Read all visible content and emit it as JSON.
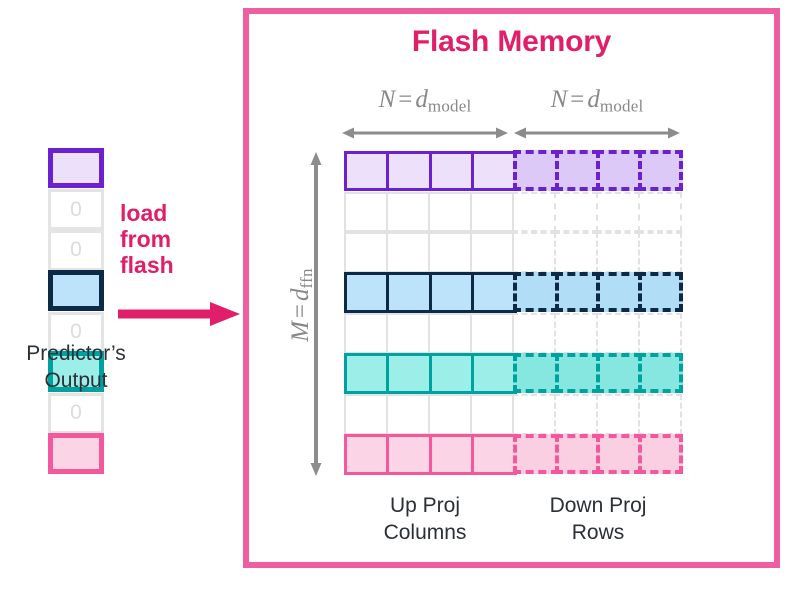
{
  "frame": {
    "title": "Flash Memory",
    "border_color": "#ef5e9e",
    "title_color": "#e01e6a"
  },
  "dimension_labels": {
    "n_var": "N",
    "n_eq": "=",
    "n_d": "d",
    "n_sub": "model",
    "m_var": "M",
    "m_eq": "=",
    "m_d": "d",
    "m_sub": "ffn",
    "arrow_color": "#8c8c8c"
  },
  "captions": {
    "up_proj": "Up Proj\nColumns",
    "up_proj_line1": "Up Proj",
    "up_proj_line2": "Columns",
    "down_proj_line1": "Down Proj",
    "down_proj_line2": "Rows",
    "predictor_line1": "Predictor’s",
    "predictor_line2": "Output",
    "text_color": "#2b3036"
  },
  "transfer": {
    "line1": "load",
    "line2": "from",
    "line3": "flash",
    "color": "#e01e6a"
  },
  "predictor_output": {
    "zero_label": "0",
    "cells": [
      {
        "state": "active",
        "color_key": "purple"
      },
      {
        "state": "zero",
        "color_key": "gray"
      },
      {
        "state": "zero",
        "color_key": "gray"
      },
      {
        "state": "active",
        "color_key": "navy"
      },
      {
        "state": "zero",
        "color_key": "gray"
      },
      {
        "state": "active",
        "color_key": "teal"
      },
      {
        "state": "zero",
        "color_key": "gray"
      },
      {
        "state": "active",
        "color_key": "pink"
      }
    ]
  },
  "matrix": {
    "rows": 8,
    "left_columns": 4,
    "right_columns": 4,
    "active_rows": [
      0,
      3,
      5,
      7
    ],
    "row_colors": [
      "purple",
      "gray",
      "gray",
      "navy",
      "gray",
      "teal",
      "gray",
      "pink"
    ]
  },
  "palette": {
    "purple": {
      "border": "#6b21cf",
      "fill_left": "#ece0fb",
      "fill_right": "#dcc9f8"
    },
    "navy": {
      "border": "#0c2a46",
      "fill_left": "#bde3fa",
      "fill_right": "#b2ddf7"
    },
    "teal": {
      "border": "#00a2a0",
      "fill_left": "#9ceee8",
      "fill_right": "#86e6e0"
    },
    "pink": {
      "border": "#f4579c",
      "fill_left": "#fbd4e6",
      "fill_right": "#fbcfe2"
    },
    "gray": {
      "border": "#e2e2e2",
      "fill_left": "#ffffff",
      "fill_right": "#ffffff"
    }
  }
}
